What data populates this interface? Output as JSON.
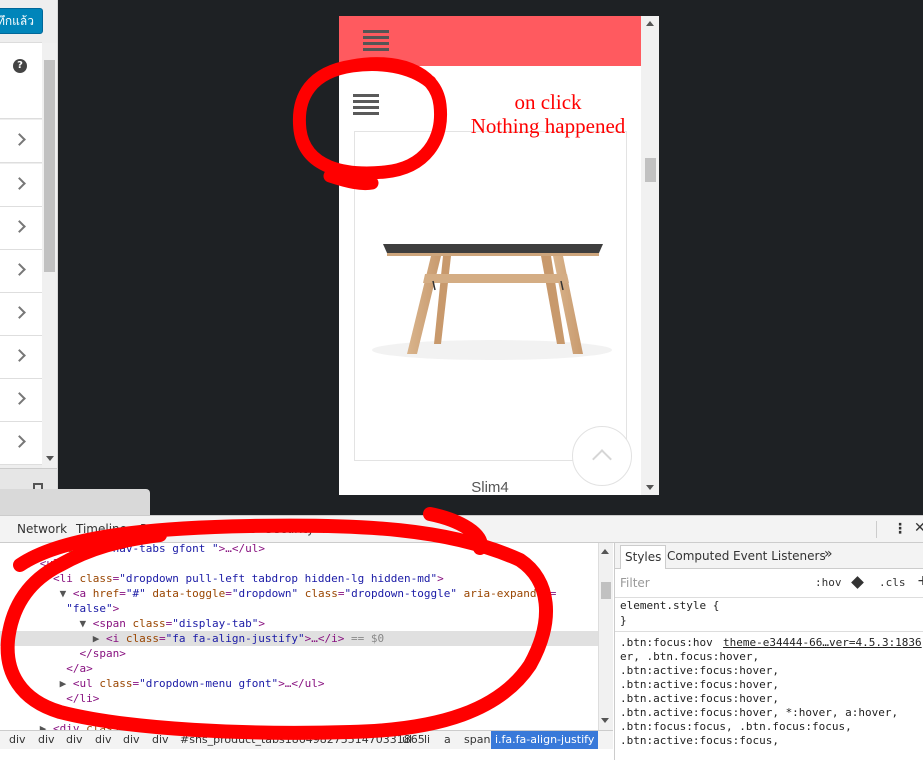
{
  "customizer": {
    "save_button_label": "บันทึกแล้ว",
    "help_icon_glyph": "?"
  },
  "preview": {
    "product_name": "Slim4",
    "header_color": "#ff5a5f"
  },
  "annotation": {
    "line1": "on click",
    "line2": "Nothing happened",
    "color": "#ff0000"
  },
  "devtools": {
    "tabs": [
      "Network",
      "Timeline",
      "Profiles",
      "Resources",
      "Security",
      "Audits"
    ],
    "menu_glyph": "⋮",
    "close_glyph": "✕",
    "elements": {
      "line0_open": "<",
      "line0_tag": "li",
      "line0_attr": "class",
      "line0_val": "\"nav-tabs gfont \"",
      "line0_rest": ">…</ul>",
      "ul_open": "<ul>",
      "li_tag": "li",
      "li_attr": "class",
      "li_val": "\"dropdown pull-left tabdrop hidden-lg hidden-md\"",
      "a_tag": "a",
      "a_href_attr": "href",
      "a_href_val": "\"#\"",
      "a_toggle_attr": "data-toggle",
      "a_toggle_val": "\"dropdown\"",
      "a_class_attr": "class",
      "a_class_val": "\"dropdown-toggle\"",
      "a_aria_attr": "aria-expanded",
      "a_aria_val": "\"false\"",
      "span_tag": "span",
      "span_attr": "class",
      "span_val": "\"display-tab\"",
      "i_tag": "i",
      "i_attr": "class",
      "i_val": "\"fa fa-align-justify\"",
      "i_rest": ">…</i>",
      "i_eq": " == $0",
      "span_close": "</span>",
      "a_close": "</a>",
      "ul2_tag": "ul",
      "ul2_attr": "class",
      "ul2_val": "\"dropdown-menu gfont\"",
      "ul2_rest": ">…</ul>",
      "li_close": "</li>",
      "ul_close": "</ul>",
      "div_tag": "div",
      "div_attr": "class",
      "div_val": "\"tab"
    },
    "breadcrumbs": [
      "div",
      "div",
      "div",
      "div",
      "div",
      "div",
      "#sns_product_tabs18649827551470331865",
      "ul",
      "li",
      "a",
      "span",
      "i.fa.fa-align-justify"
    ],
    "styles": {
      "tabs": [
        "Styles",
        "Computed",
        "Event Listeners",
        "»"
      ],
      "filter_placeholder": "Filter",
      "hov": ":hov",
      "cls": ".cls",
      "plus": "+",
      "element_style": "element.style {",
      "close_brace": "}",
      "rule_selector_1": ".btn:focus:hov",
      "rule_link": "theme-e34444-66…ver=4.5.3:1836",
      "rule_lines": [
        "er, .btn.focus:hover,",
        ".btn:active:focus:hover,",
        ".btn:active:focus:hover,",
        ".btn.active:focus:hover,",
        ".btn.active:focus:hover, *:hover, a:hover,",
        ".btn:focus:focus, .btn.focus:focus,",
        ".btn:active:focus:focus,"
      ]
    }
  }
}
